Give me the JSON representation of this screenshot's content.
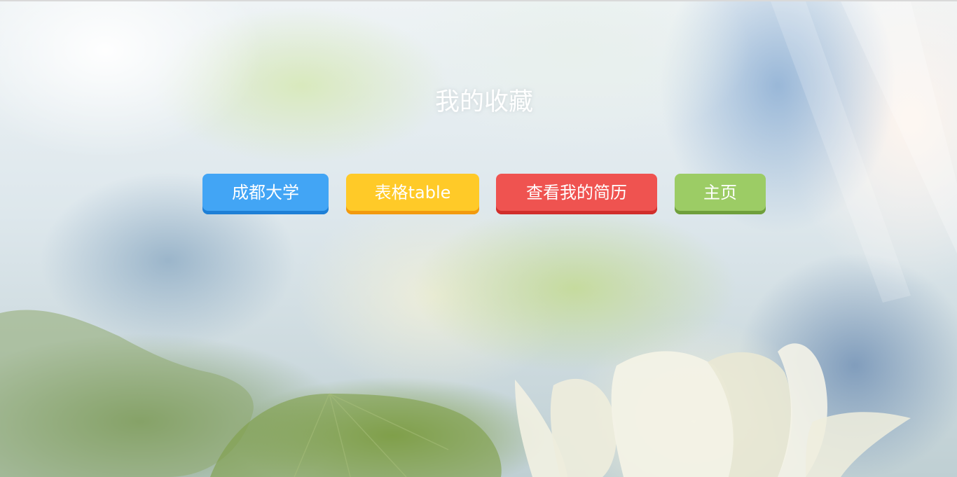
{
  "page": {
    "title": "我的收藏"
  },
  "nav": {
    "buttons": [
      {
        "label": "成都大学",
        "color": "#42a5f5",
        "shade": "#1e7fd6"
      },
      {
        "label": "表格table",
        "color": "#ffca28",
        "shade": "#f29a0f"
      },
      {
        "label": "查看我的简历",
        "color": "#ef5350",
        "shade": "#d12e2b"
      },
      {
        "label": "主页",
        "color": "#9ccc65",
        "shade": "#6f9f3c"
      }
    ]
  },
  "background": {
    "palette": {
      "sky": "#eef3f5",
      "mist_blue": "#9fb9d1",
      "leaf_green": "#7e9e46",
      "lotus": "#eeeeda"
    }
  }
}
